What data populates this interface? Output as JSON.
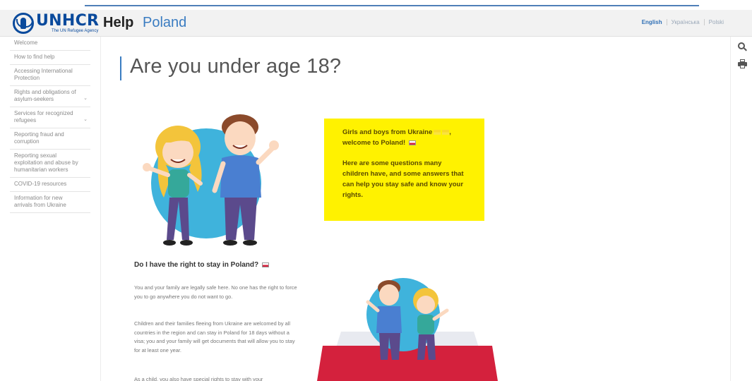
{
  "header": {
    "logo_text": "UNHCR",
    "logo_tagline": "The UN Refugee Agency",
    "help_label": "Help",
    "country_label": "Poland",
    "languages": [
      {
        "label": "English",
        "active": true
      },
      {
        "label": "Українська",
        "active": false
      },
      {
        "label": "Polski",
        "active": false
      }
    ]
  },
  "sidebar": {
    "items": [
      {
        "label": "Welcome",
        "has_submenu": false
      },
      {
        "label": "How to find help",
        "has_submenu": false
      },
      {
        "label": "Accessing International Protection",
        "has_submenu": false
      },
      {
        "label": "Rights and obligations of asylum-seekers",
        "has_submenu": true
      },
      {
        "label": "Services for recognized refugees",
        "has_submenu": true
      },
      {
        "label": "Reporting fraud and corruption",
        "has_submenu": false
      },
      {
        "label": "Reporting sexual exploitation and abuse by humanitarian workers",
        "has_submenu": false
      },
      {
        "label": "COVID-19 resources",
        "has_submenu": false
      },
      {
        "label": "Information for new arrivals from Ukraine",
        "has_submenu": false
      }
    ]
  },
  "toolbar": {
    "search_icon": "search-icon",
    "print_icon": "print-icon"
  },
  "main": {
    "title": "Are you under age 18?",
    "yellow_box": {
      "line1": "Girls and boys from Ukraine",
      "line2": "welcome to Poland!",
      "paragraph2": "Here are some questions many children have, and some answers that can help you stay safe and know your rights.",
      "color": "#fff200"
    },
    "section_heading": "Do I have the right to stay in Poland?",
    "paragraphs": [
      "You and your family are legally safe here. No one has the right to force you to go anywhere you do not want to go.",
      "Children and their families fleeing from Ukraine are welcomed by all countries in the region and can stay in Poland for 18 days without a visa; you and your family will get documents that will allow you to stay for at least one year.",
      "As a child, you also have special rights to stay with your"
    ]
  },
  "colors": {
    "brand_blue": "#0a4a9c",
    "accent_blue": "#3a7cc1",
    "flag_red": "#d4213d"
  }
}
